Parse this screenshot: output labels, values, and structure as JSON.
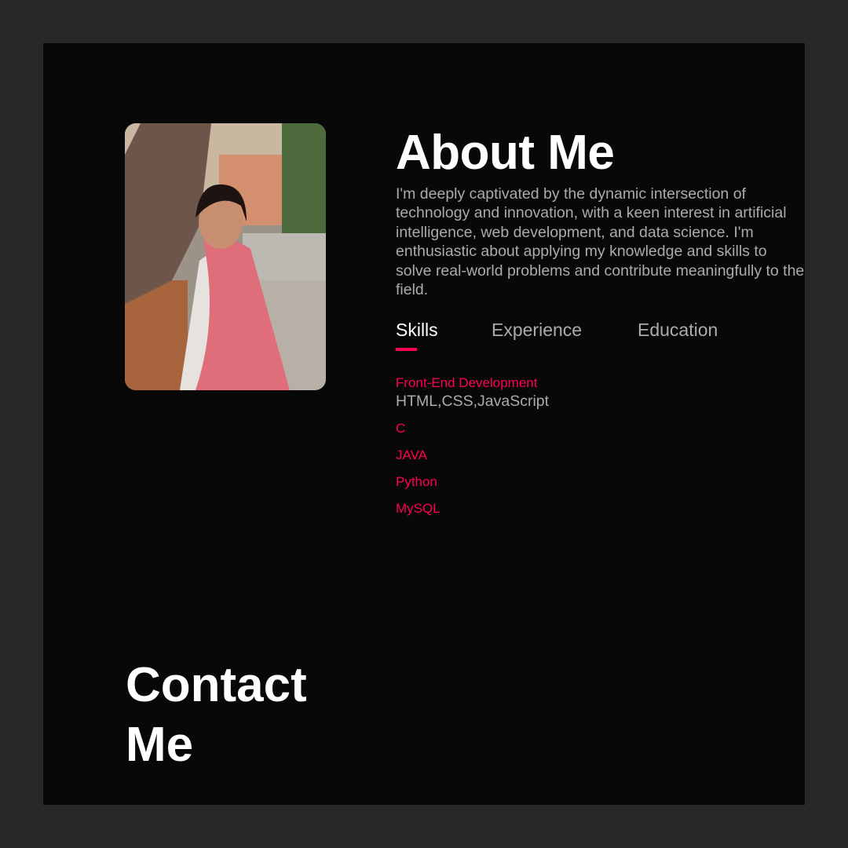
{
  "about": {
    "title": "About Me",
    "description": "I'm deeply captivated by the dynamic intersection of technology and innovation, with a keen interest in artificial intelligence, web development, and data science. I'm enthusiastic about applying my knowledge and skills to solve real-world problems and contribute meaningfully to the field."
  },
  "tabs": [
    {
      "label": "Skills",
      "active": true
    },
    {
      "label": "Experience",
      "active": false
    },
    {
      "label": "Education",
      "active": false
    }
  ],
  "skills": [
    {
      "name": "Front-End Development",
      "detail": "HTML,CSS,JavaScript"
    },
    {
      "name": "C"
    },
    {
      "name": "JAVA"
    },
    {
      "name": "Python"
    },
    {
      "name": "MySQL"
    }
  ],
  "contact": {
    "title": "Contact Me"
  },
  "colors": {
    "accent": "#ff004f",
    "background": "#080808",
    "outer_background": "#2a2727",
    "muted_text": "#ababab"
  }
}
